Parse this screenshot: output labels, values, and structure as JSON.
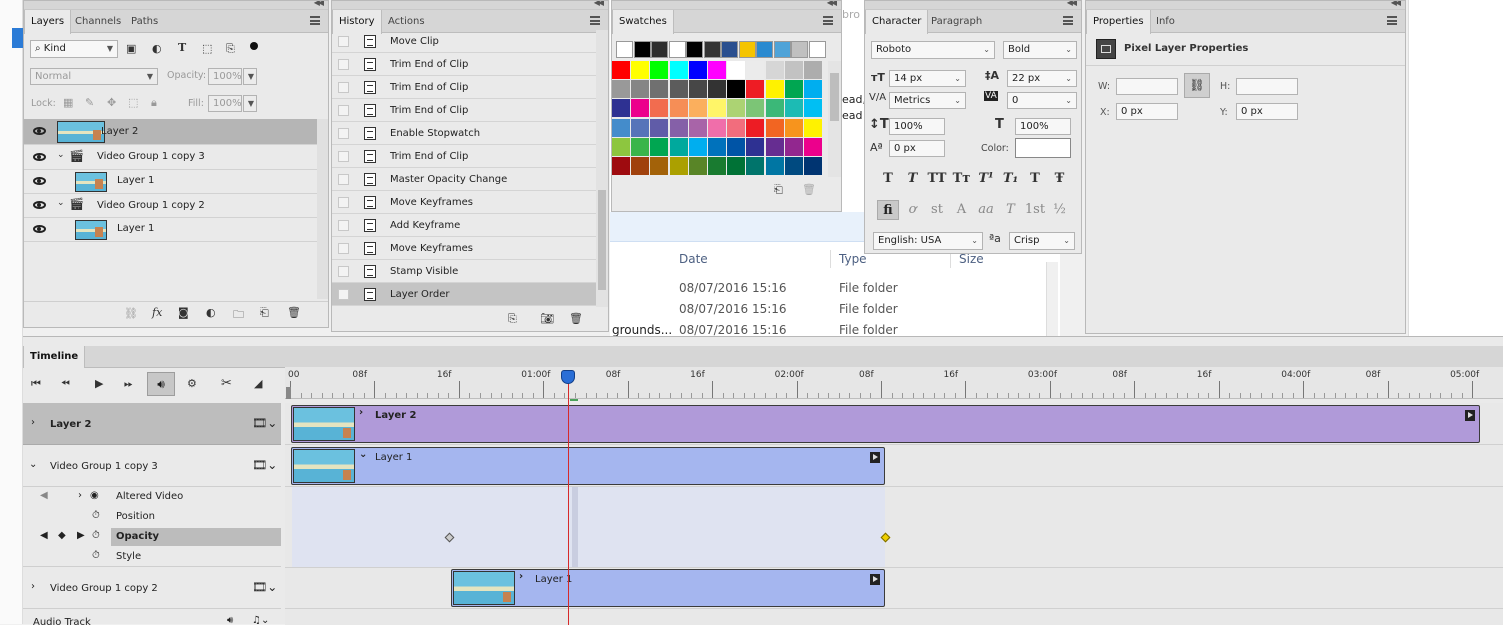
{
  "layers_panel": {
    "tabs": [
      "Layers",
      "Channels",
      "Paths"
    ],
    "filter_kind": "Kind",
    "blend_mode": "Normal",
    "opacity_label": "Opacity:",
    "opacity_value": "100%",
    "lock_label": "Lock:",
    "fill_label": "Fill:",
    "fill_value": "100%",
    "layers": [
      {
        "name": "Layer 2",
        "type": "layer",
        "selected": true
      },
      {
        "name": "Video Group 1 copy 3",
        "type": "group"
      },
      {
        "name": "Layer 1",
        "type": "layer"
      },
      {
        "name": "Video Group 1 copy 2",
        "type": "group"
      },
      {
        "name": "Layer 1",
        "type": "layer"
      }
    ]
  },
  "history_panel": {
    "tabs": [
      "History",
      "Actions"
    ],
    "items": [
      "Move Clip",
      "Trim End of Clip",
      "Trim End of Clip",
      "Trim End of Clip",
      "Enable Stopwatch",
      "Trim End of Clip",
      "Master Opacity Change",
      "Move Keyframes",
      "Add Keyframe",
      "Move Keyframes",
      "Stamp Visible",
      "Layer Order"
    ]
  },
  "swatches_panel": {
    "tabs": [
      "Swatches"
    ],
    "recent": [
      "#ffffff",
      "#000000",
      "#2e2e2e",
      "#ffffff",
      "#000000",
      "#333333",
      "#2a4f8f",
      "#f5c400",
      "#2a8ad0",
      "#4fa3d8",
      "#c0c0c0",
      "#ffffff"
    ],
    "grid": [
      [
        "#ff0000",
        "#ffff00",
        "#00ff00",
        "#00ffff",
        "#0000ff",
        "#ff00ff",
        "#ffffff",
        "#ebebeb",
        "#d6d6d6",
        "#c2c2c2",
        "#adadad"
      ],
      [
        "#999999",
        "#858585",
        "#707070",
        "#5c5c5c",
        "#474747",
        "#333333",
        "#000000",
        "#ee1c24",
        "#fff200",
        "#00a651",
        "#00aeef"
      ],
      [
        "#2e3192",
        "#ec008c",
        "#f26c4f",
        "#f68e56",
        "#fbaf5d",
        "#fff568",
        "#acd373",
        "#7cc576",
        "#3bb878",
        "#1cbbb4",
        "#00bff3"
      ],
      [
        "#448ccb",
        "#5674b9",
        "#605ca8",
        "#8560a8",
        "#a864a8",
        "#f06eaa",
        "#f26d7d",
        "#ed1c24",
        "#f26522",
        "#f7941d",
        "#fff200"
      ],
      [
        "#8dc63f",
        "#39b54a",
        "#00a651",
        "#00a99d",
        "#00aeef",
        "#0072bc",
        "#0054a6",
        "#2e3192",
        "#662d91",
        "#92278f",
        "#ec008c"
      ],
      [
        "#9e0b0f",
        "#a0410d",
        "#a36209",
        "#aba000",
        "#598527",
        "#197b30",
        "#007236",
        "#00746b",
        "#0076a3",
        "#004a80",
        "#003471"
      ]
    ]
  },
  "character_panel": {
    "tabs": [
      "Character",
      "Paragraph"
    ],
    "font_family": "Roboto",
    "font_style": "Bold",
    "font_size": "14 px",
    "leading": "22 px",
    "kerning": "Metrics",
    "tracking": "0",
    "vertical_scale": "100%",
    "horizontal_scale": "100%",
    "baseline_shift": "0 px",
    "color_label": "Color:",
    "language": "English: USA",
    "antialias": "Crisp",
    "style_buttons": [
      "T",
      "T",
      "TT",
      "Tт",
      "T¹",
      "T₁",
      "T",
      "Ŧ"
    ],
    "opentype_buttons": [
      "fi",
      "ơ",
      "st",
      "A",
      "aa",
      "T",
      "1st",
      "½"
    ]
  },
  "properties_panel": {
    "tabs": [
      "Properties",
      "Info"
    ],
    "title": "Pixel Layer Properties",
    "w_label": "W:",
    "h_label": "H:",
    "x_label": "X:",
    "x_value": "0 px",
    "y_label": "Y:",
    "y_value": "0 px"
  },
  "explorer": {
    "headers": [
      "Date",
      "Type",
      "Size"
    ],
    "rows": [
      {
        "date": "08/07/2016 15:16",
        "type": "File folder"
      },
      {
        "date": "08/07/2016 15:16",
        "type": "File folder"
      },
      {
        "date": "08/07/2016 15:16",
        "type": "File folder"
      }
    ],
    "partial_text": [
      "bro",
      "ead,",
      "ead"
    ],
    "partial_name": "grounds..."
  },
  "timeline": {
    "title": "Timeline",
    "ruler": [
      "00",
      "08f",
      "16f",
      "01:00f",
      "08f",
      "16f",
      "02:00f",
      "08f",
      "16f",
      "03:00f",
      "08f",
      "16f",
      "04:00f",
      "08f",
      "05:00f"
    ],
    "tracks": [
      {
        "name": "Layer 2",
        "clip_label": "Layer 2"
      },
      {
        "name": "Video Group 1 copy 3",
        "clip_label": "Layer 1"
      },
      {
        "name": "Altered Video"
      },
      {
        "name": "Position"
      },
      {
        "name": "Opacity"
      },
      {
        "name": "Style"
      },
      {
        "name": "Video Group 1 copy 2",
        "clip_label": "Layer 1"
      },
      {
        "name": "Audio Track"
      }
    ],
    "colors": {
      "layer2_clip": "#b09ad9",
      "video_clip": "#a5b6ef",
      "playhead": "#d62a2a",
      "keyframe_active": "#f0d000"
    }
  }
}
